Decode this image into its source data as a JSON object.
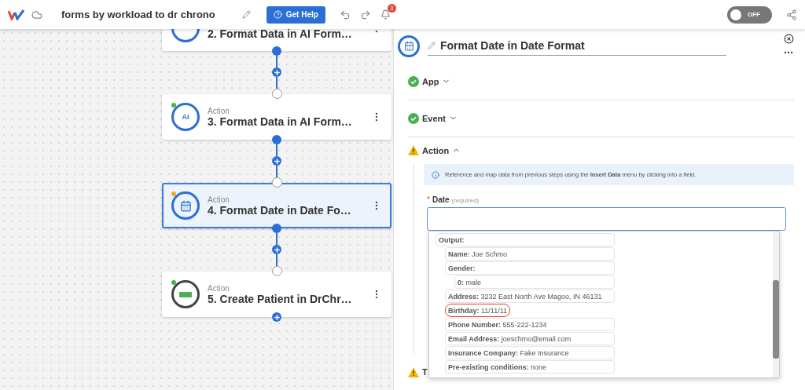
{
  "app_bar": {
    "title": "forms by workload to dr chrono",
    "help_button": "Get Help",
    "notification_count": "3",
    "toggle": {
      "label": "OFF",
      "on": false
    }
  },
  "canvas": {
    "nodes": [
      {
        "kind": "ai",
        "title": "2. Format Data in AI Form…",
        "selected": false
      },
      {
        "kind": "ai",
        "icon_text": "AI",
        "type_label": "Action",
        "title": "3. Format Data in AI Form…",
        "color": "#4caf50",
        "selected": false
      },
      {
        "kind": "calendar",
        "type_label": "Action",
        "title": "4. Format Date in Date Fo…",
        "color": "#f5a623",
        "selected": true
      },
      {
        "kind": "app",
        "type_label": "Action",
        "title": "5. Create Patient in DrChr…",
        "color": "#4caf50",
        "selected": false
      }
    ]
  },
  "panel": {
    "title": "Format Date in Date Format",
    "sections": [
      {
        "title": "App",
        "complete": true,
        "expanded": false
      },
      {
        "title": "Event",
        "complete": true,
        "expanded": false
      },
      {
        "title": "Action",
        "complete": false,
        "expanded": true
      },
      {
        "title": "T",
        "complete": false
      }
    ],
    "info": "Reference and map data from previous steps using the **Insert Data** menu by clicking into a field.",
    "field": {
      "required_mark": "*",
      "label": "Date",
      "hint": "(required)"
    },
    "output": {
      "key": "Output:",
      "circled": false,
      "children": [
        {
          "key": "Name:",
          "value": "Joe Schmo",
          "circled": false
        },
        {
          "key": "Gender:",
          "circled": false,
          "children": [
            {
              "key": "0:",
              "value": "male",
              "circled": false
            }
          ]
        },
        {
          "key": "Address:",
          "value": "3232 East North Ave Magoo, IN 46131",
          "circled": false
        },
        {
          "key": "Birthday:",
          "value": "11/11/11",
          "circled": true
        },
        {
          "key": "Phone Number:",
          "value": "555-222-1234",
          "circled": false
        },
        {
          "key": "Email Address:",
          "value": "joeschmo@email.com",
          "circled": false
        },
        {
          "key": "Insurance Company:",
          "value": "Fake Insurance",
          "circled": false
        },
        {
          "key": "Pre-existing conditions:",
          "value": "none",
          "circled": false
        }
      ]
    }
  }
}
